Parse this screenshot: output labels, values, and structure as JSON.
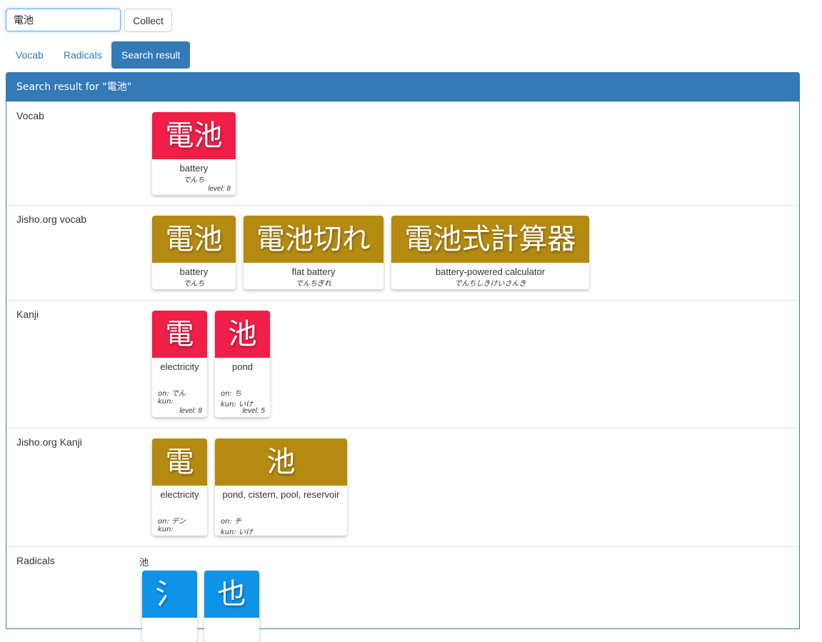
{
  "search": {
    "value": "電池"
  },
  "collect_label": "Collect",
  "tabs": [
    {
      "label": "Vocab",
      "active": false
    },
    {
      "label": "Radicals",
      "active": false
    },
    {
      "label": "Search result",
      "active": true
    }
  ],
  "panel": {
    "heading": "Search result for \"電池\""
  },
  "colors": {
    "wanikani": "#ef1f48",
    "jisho": "#b58a10",
    "radical": "#0d93e8",
    "primary": "#337ab7"
  },
  "sections": {
    "vocab": {
      "label": "Vocab",
      "cards": [
        {
          "chars": "電池",
          "meaning": "battery",
          "reading": "でんち",
          "level": "level: 8"
        }
      ]
    },
    "jisho_vocab": {
      "label": "Jisho.org vocab",
      "cards": [
        {
          "chars": "電池",
          "meaning": "battery",
          "reading": "でんち"
        },
        {
          "chars": "電池切れ",
          "meaning": "flat battery",
          "reading": "でんちぎれ"
        },
        {
          "chars": "電池式計算器",
          "meaning": "battery-powered calculator",
          "reading": "でんちしきけいさんき"
        }
      ]
    },
    "kanji": {
      "label": "Kanji",
      "cards": [
        {
          "chars": "電",
          "meaning": "electricity",
          "on": "on: でん",
          "kun": "kun:",
          "level": "level: 8"
        },
        {
          "chars": "池",
          "meaning": "pond",
          "on": "on: ち",
          "kun": "kun: いけ",
          "level": "level: 5"
        }
      ]
    },
    "jisho_kanji": {
      "label": "Jisho.org Kanji",
      "cards": [
        {
          "chars": "電",
          "meaning": "electricity",
          "on": "on: デン",
          "kun": "kun:"
        },
        {
          "chars": "池",
          "meaning": "pond, cistern, pool, reservoir",
          "on": "on: チ",
          "kun": "kun: いけ"
        }
      ]
    },
    "radicals": {
      "label": "Radicals",
      "kanji_heading": "池",
      "cards": [
        {
          "chars": "氵"
        },
        {
          "chars": "也"
        }
      ]
    }
  }
}
